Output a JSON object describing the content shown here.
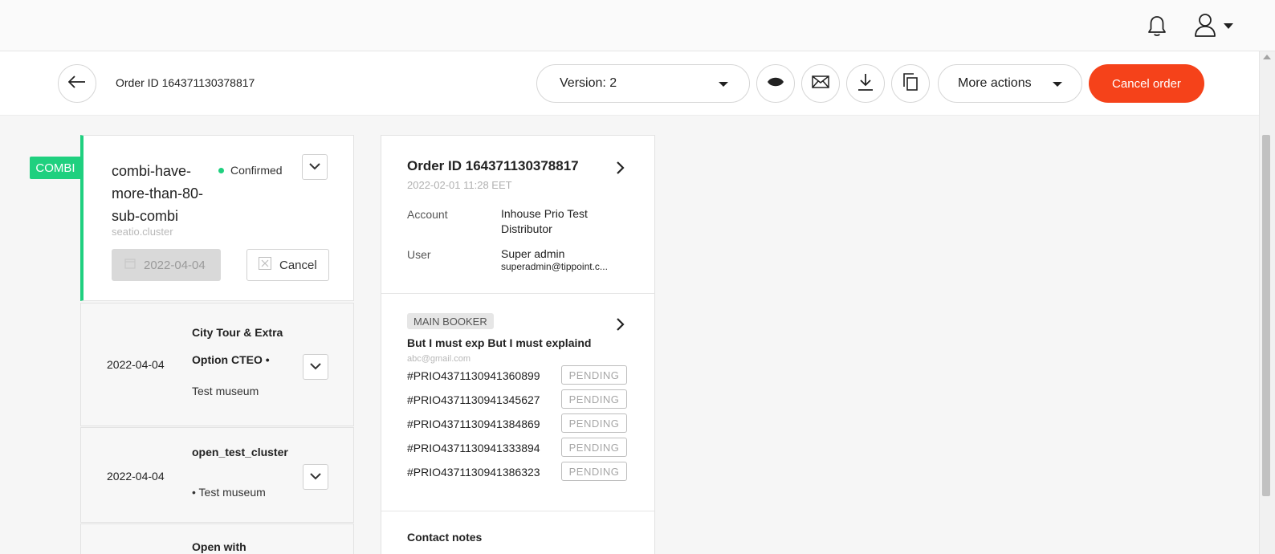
{
  "header": {
    "icons": [
      "bell-icon",
      "user-icon",
      "caret-down-icon"
    ]
  },
  "subheader": {
    "order_id_label": "Order ID 164371130378817",
    "version_label": "Version: 2",
    "more_actions_label": "More actions",
    "cancel_order_label": "Cancel order",
    "icons": [
      "back-arrow-icon",
      "eye-icon",
      "mail-icon",
      "download-icon",
      "copy-icon"
    ]
  },
  "product": {
    "badge": "COMBI",
    "title": "combi-have-more-than-80-sub-combi",
    "subtitle": "seatio.cluster",
    "status": "Confirmed",
    "date": "2022-04-04",
    "cancel_label": "Cancel"
  },
  "sub_products": [
    {
      "date": "2022-04-04",
      "title": "City Tour & Extra Option CTEO •",
      "venue": "Test museum"
    },
    {
      "date": "2022-04-04",
      "title": "open_test_cluster",
      "venue": "• Test museum"
    },
    {
      "date": "",
      "title": "Open with",
      "venue": ""
    }
  ],
  "order": {
    "title": "Order ID 164371130378817",
    "datetime": "2022-02-01 11:28 EET",
    "account_label": "Account",
    "account_value": "Inhouse Prio Test Distributor",
    "user_label": "User",
    "user_name": "Super admin",
    "user_email": "superadmin@tippoint.c..."
  },
  "booker": {
    "badge": "MAIN BOOKER",
    "name": "But I must exp But I must explaind",
    "email": "abc@gmail.com"
  },
  "tickets": [
    {
      "code": "#PRIO4371130941360899",
      "status": "PENDING"
    },
    {
      "code": "#PRIO4371130941345627",
      "status": "PENDING"
    },
    {
      "code": "#PRIO4371130941384869",
      "status": "PENDING"
    },
    {
      "code": "#PRIO4371130941333894",
      "status": "PENDING"
    },
    {
      "code": "#PRIO4371130941386323",
      "status": "PENDING"
    }
  ],
  "contact_notes_label": "Contact notes",
  "colors": {
    "accent_green": "#1fd07f",
    "cancel_order_red": "#f5421a"
  }
}
